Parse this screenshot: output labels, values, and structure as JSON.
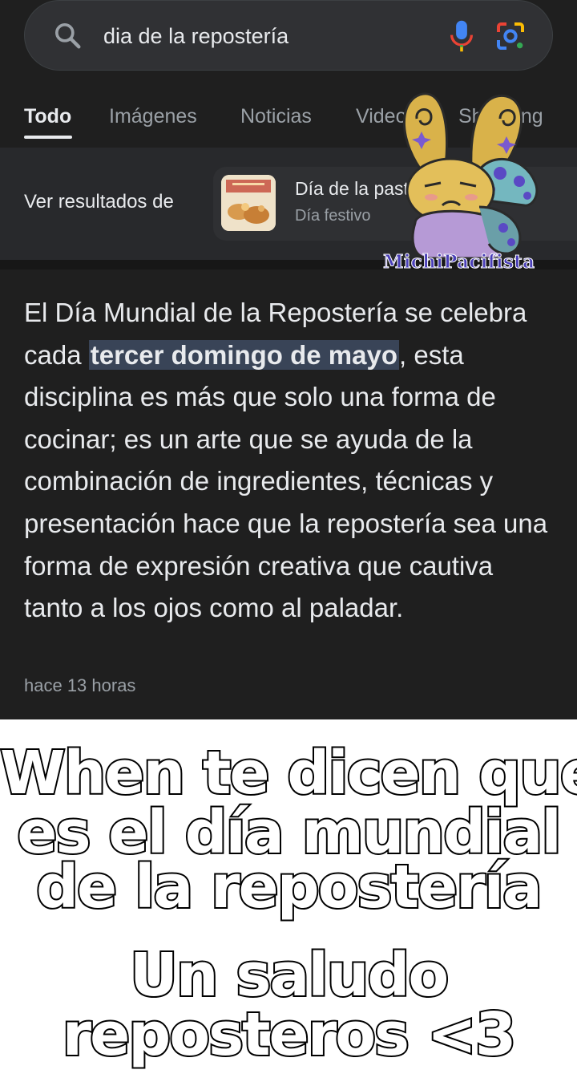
{
  "search": {
    "query": "dia de la repostería"
  },
  "tabs": [
    {
      "label": "Todo"
    },
    {
      "label": "Imágenes"
    },
    {
      "label": "Noticias"
    },
    {
      "label": "Videos"
    },
    {
      "label": "Shopping"
    }
  ],
  "see_results": {
    "label": "Ver resultados de",
    "chip_title": "Día de la pastelería",
    "chip_subtitle": "Día festivo"
  },
  "snippet": {
    "before": "El Día Mundial de la Repostería se celebra cada ",
    "highlight": "tercer domingo de mayo",
    "after": ", esta disciplina es más que solo una forma de cocinar; es un arte que se ayuda de la combinación de ingredientes, técnicas y presentación hace que la repostería sea una forma de expresión creativa que cautiva tanto a los ojos como al paladar.",
    "time": "hace 13 horas"
  },
  "watermark": "MichiPacifista",
  "caption": {
    "line1": "When te dicen que",
    "line2": "es el día mundial",
    "line3": "de la repostería",
    "line4": "Un saludo",
    "line5": "reposteros <3"
  },
  "icons": [
    "search-icon",
    "mic-icon",
    "lens-icon"
  ],
  "colors": {
    "background": "#1f1f1f",
    "highlight": "#394457",
    "text": "#e8eaed",
    "muted": "#9aa0a6"
  }
}
